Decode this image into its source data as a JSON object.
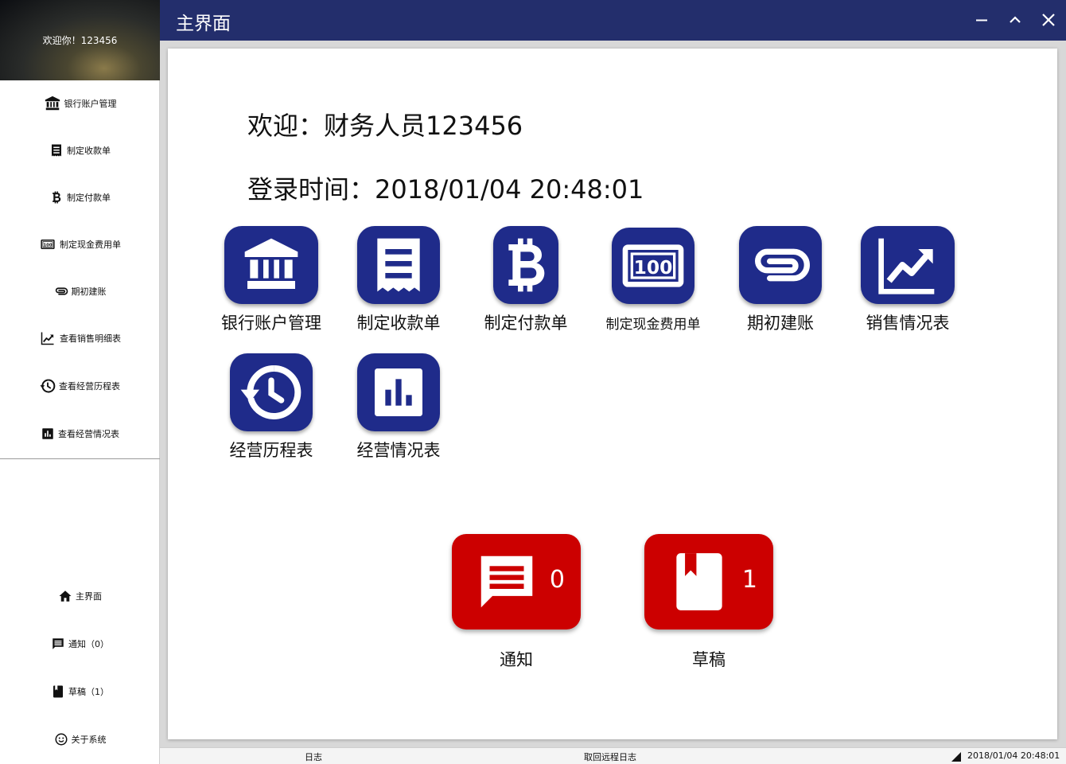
{
  "window": {
    "title": "主界面",
    "controls": [
      "minimize-icon",
      "restore-icon",
      "close-icon"
    ]
  },
  "sidebar": {
    "welcome": "欢迎你！123456",
    "items": [
      {
        "label": "银行账户管理",
        "icon": "bank-icon"
      },
      {
        "label": "制定收款单",
        "icon": "receipt-icon"
      },
      {
        "label": "制定付款单",
        "icon": "bitcoin-icon"
      },
      {
        "label": "制定现金费用单",
        "icon": "cash-icon"
      },
      {
        "label": "期初建账",
        "icon": "paperclip-icon"
      },
      {
        "label": "查看销售明细表",
        "icon": "trending-up-icon"
      },
      {
        "label": "查看经营历程表",
        "icon": "history-icon"
      },
      {
        "label": "查看经营情况表",
        "icon": "bar-chart-icon"
      }
    ],
    "bottom_items": [
      {
        "label": "主界面",
        "icon": "home-icon"
      },
      {
        "label": "通知（0）",
        "icon": "message-icon"
      },
      {
        "label": "草稿（1）",
        "icon": "book-icon"
      },
      {
        "label": "关于系统",
        "icon": "smiley-icon"
      }
    ]
  },
  "main": {
    "welcome_text": "欢迎：财务人员123456",
    "login_time_text": "登录时间：2018/01/04 20:48:01",
    "tiles": [
      {
        "label": "银行账户管理",
        "icon": "bank-icon"
      },
      {
        "label": "制定收款单",
        "icon": "receipt-icon"
      },
      {
        "label": "制定付款单",
        "icon": "bitcoin-icon"
      },
      {
        "label": "制定现金费用单",
        "icon": "cash-icon"
      },
      {
        "label": "期初建账",
        "icon": "paperclip-icon"
      },
      {
        "label": "销售情况表",
        "icon": "trending-up-icon"
      },
      {
        "label": "经营历程表",
        "icon": "history-icon"
      },
      {
        "label": "经营情况表",
        "icon": "bar-chart-icon"
      }
    ],
    "notify": {
      "label": "通知",
      "count": "0",
      "icon": "message-icon"
    },
    "draft": {
      "label": "草稿",
      "count": "1",
      "icon": "book-icon"
    }
  },
  "statusbar": {
    "log": "日志",
    "remote_log": "取回远程日志",
    "time": "2018/01/04 20:48:01"
  },
  "colors": {
    "titlebar": "#232e6c",
    "tile_blue": "#1f2b8a",
    "badge_red": "#cc0000"
  }
}
